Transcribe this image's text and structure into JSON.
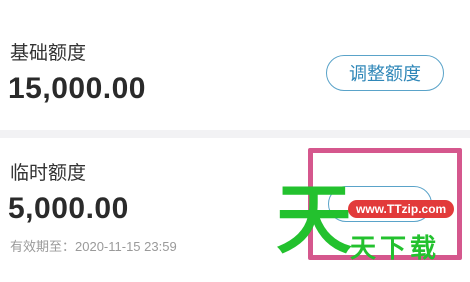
{
  "base_credit": {
    "label": "基础额度",
    "amount": "15,000.00",
    "adjust_button": "调整额度"
  },
  "temp_credit": {
    "label": "临时额度",
    "amount": "5,000.00",
    "expiry": "有效期至：2020-11-15 23:59"
  },
  "watermark": {
    "big_char": "天",
    "url": "www.TTzip.com",
    "subtitle": "天下载"
  },
  "colors": {
    "accent": "#2f87b8",
    "highlight": "#d5578d",
    "watermark_green": "#23c12e"
  }
}
